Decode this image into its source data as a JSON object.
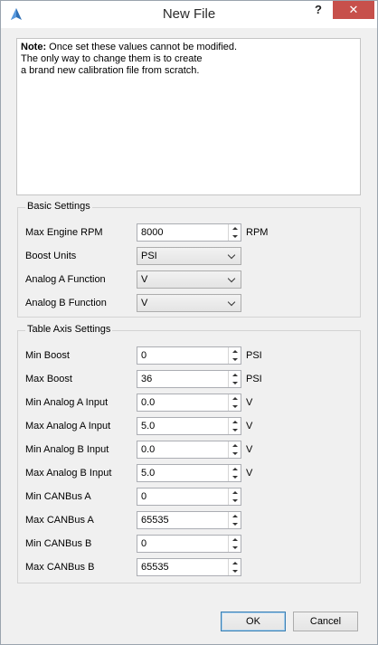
{
  "window": {
    "title": "New File",
    "help_label": "?",
    "close_label": "✕"
  },
  "note": {
    "bold": "Note:",
    "text": " Once set these values cannot be modified.\nThe only way to change them is to create\na brand new calibration file from scratch."
  },
  "basic_settings": {
    "title": "Basic Settings",
    "max_engine_rpm": {
      "label": "Max Engine RPM",
      "value": "8000",
      "unit": "RPM"
    },
    "boost_units": {
      "label": "Boost Units",
      "value": "PSI"
    },
    "analog_a_function": {
      "label": "Analog A Function",
      "value": "V"
    },
    "analog_b_function": {
      "label": "Analog B Function",
      "value": "V"
    }
  },
  "table_axis_settings": {
    "title": "Table Axis Settings",
    "rows": [
      {
        "label": "Min Boost",
        "value": "0",
        "unit": "PSI"
      },
      {
        "label": "Max Boost",
        "value": "36",
        "unit": "PSI"
      },
      {
        "label": "Min Analog A Input",
        "value": "0.0",
        "unit": "V"
      },
      {
        "label": "Max Analog A Input",
        "value": "5.0",
        "unit": "V"
      },
      {
        "label": "Min Analog B Input",
        "value": "0.0",
        "unit": "V"
      },
      {
        "label": "Max Analog B Input",
        "value": "5.0",
        "unit": "V"
      },
      {
        "label": "Min CANBus A",
        "value": "0",
        "unit": ""
      },
      {
        "label": "Max CANBus A",
        "value": "65535",
        "unit": ""
      },
      {
        "label": "Min CANBus B",
        "value": "0",
        "unit": ""
      },
      {
        "label": "Max CANBus B",
        "value": "65535",
        "unit": ""
      }
    ]
  },
  "buttons": {
    "ok": "OK",
    "cancel": "Cancel"
  }
}
